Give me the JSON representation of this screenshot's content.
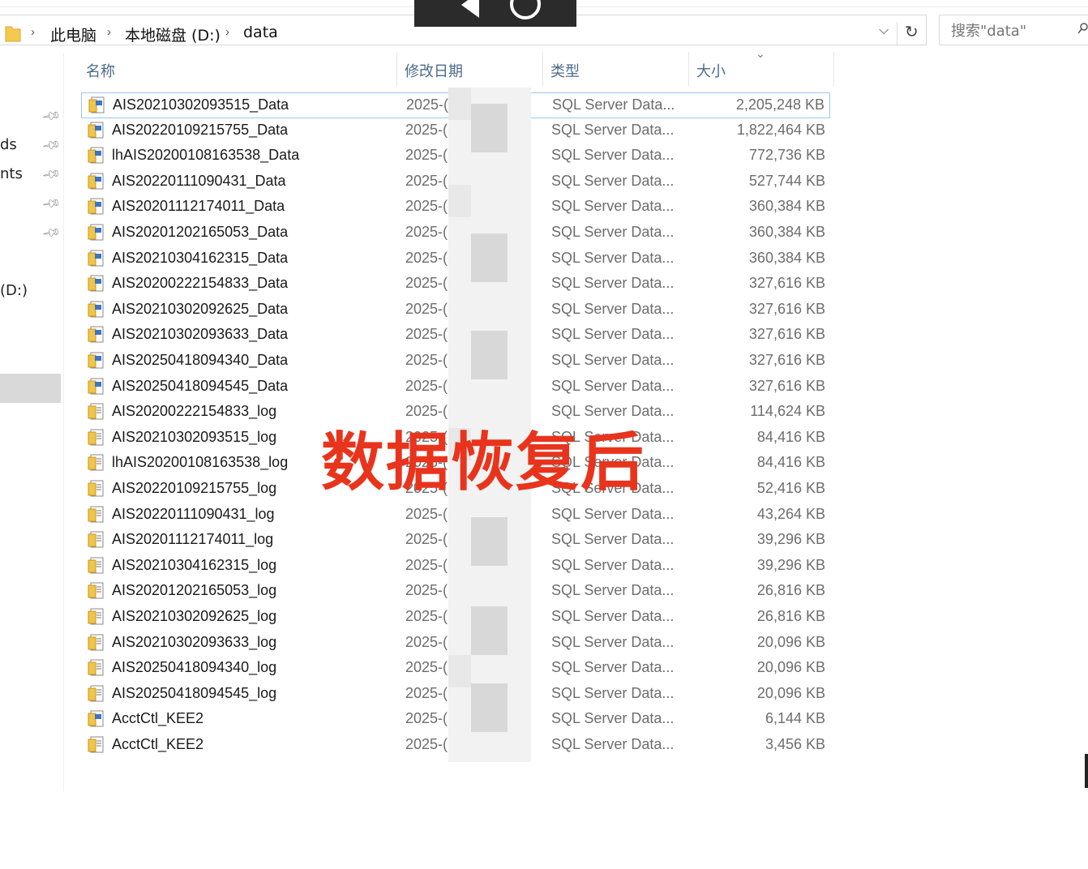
{
  "address_bar": {
    "breadcrumbs": [
      "此电脑",
      "本地磁盘 (D:)",
      "data"
    ],
    "search_placeholder": "搜索\"data\""
  },
  "nav_pane": {
    "items": [
      "ds",
      "nts",
      "(D:)"
    ]
  },
  "columns": {
    "name": "名称",
    "date": "修改日期",
    "type": "类型",
    "size": "大小"
  },
  "overlay_caption": "数据恢复后",
  "files": [
    {
      "name": "AIS20210302093515_Data",
      "date": "2025-(",
      "type": "SQL Server Data...",
      "size": "2,205,248 KB",
      "kind": "data"
    },
    {
      "name": "AIS20220109215755_Data",
      "date": "2025-(",
      "type": "SQL Server Data...",
      "size": "1,822,464 KB",
      "kind": "data"
    },
    {
      "name": "lhAIS20200108163538_Data",
      "date": "2025-(",
      "type": "SQL Server Data...",
      "size": "772,736 KB",
      "kind": "data"
    },
    {
      "name": "AIS20220111090431_Data",
      "date": "2025-(",
      "type": "SQL Server Data...",
      "size": "527,744 KB",
      "kind": "data"
    },
    {
      "name": "AIS20201112174011_Data",
      "date": "2025-(",
      "type": "SQL Server Data...",
      "size": "360,384 KB",
      "kind": "data"
    },
    {
      "name": "AIS20201202165053_Data",
      "date": "2025-(",
      "type": "SQL Server Data...",
      "size": "360,384 KB",
      "kind": "data"
    },
    {
      "name": "AIS20210304162315_Data",
      "date": "2025-(",
      "type": "SQL Server Data...",
      "size": "360,384 KB",
      "kind": "data"
    },
    {
      "name": "AIS20200222154833_Data",
      "date": "2025-(",
      "type": "SQL Server Data...",
      "size": "327,616 KB",
      "kind": "data"
    },
    {
      "name": "AIS20210302092625_Data",
      "date": "2025-(",
      "type": "SQL Server Data...",
      "size": "327,616 KB",
      "kind": "data"
    },
    {
      "name": "AIS20210302093633_Data",
      "date": "2025-(",
      "type": "SQL Server Data...",
      "size": "327,616 KB",
      "kind": "data"
    },
    {
      "name": "AIS20250418094340_Data",
      "date": "2025-(",
      "type": "SQL Server Data...",
      "size": "327,616 KB",
      "kind": "data"
    },
    {
      "name": "AIS20250418094545_Data",
      "date": "2025-(",
      "type": "SQL Server Data...",
      "size": "327,616 KB",
      "kind": "data"
    },
    {
      "name": "AIS20200222154833_log",
      "date": "2025-(",
      "type": "SQL Server Data...",
      "size": "114,624 KB",
      "kind": "log"
    },
    {
      "name": "AIS20210302093515_log",
      "date": "2025-(",
      "type": "SQL Server Data...",
      "size": "84,416 KB",
      "kind": "log"
    },
    {
      "name": "lhAIS20200108163538_log",
      "date": "2025-(",
      "type": "SQL Server Data...",
      "size": "84,416 KB",
      "kind": "log"
    },
    {
      "name": "AIS20220109215755_log",
      "date": "2025-(",
      "type": "SQL Server Data...",
      "size": "52,416 KB",
      "kind": "log"
    },
    {
      "name": "AIS20220111090431_log",
      "date": "2025-(",
      "type": "SQL Server Data...",
      "size": "43,264 KB",
      "kind": "log"
    },
    {
      "name": "AIS20201112174011_log",
      "date": "2025-(",
      "type": "SQL Server Data...",
      "size": "39,296 KB",
      "kind": "log"
    },
    {
      "name": "AIS20210304162315_log",
      "date": "2025-(",
      "type": "SQL Server Data...",
      "size": "39,296 KB",
      "kind": "log"
    },
    {
      "name": "AIS20201202165053_log",
      "date": "2025-(",
      "type": "SQL Server Data...",
      "size": "26,816 KB",
      "kind": "log"
    },
    {
      "name": "AIS20210302092625_log",
      "date": "2025-(",
      "type": "SQL Server Data...",
      "size": "26,816 KB",
      "kind": "log"
    },
    {
      "name": "AIS20210302093633_log",
      "date": "2025-(",
      "type": "SQL Server Data...",
      "size": "20,096 KB",
      "kind": "log"
    },
    {
      "name": "AIS20250418094340_log",
      "date": "2025-(",
      "type": "SQL Server Data...",
      "size": "20,096 KB",
      "kind": "log"
    },
    {
      "name": "AIS20250418094545_log",
      "date": "2025-(",
      "type": "SQL Server Data...",
      "size": "20,096 KB",
      "kind": "log"
    },
    {
      "name": "AcctCtl_KEE2",
      "date": "2025-(",
      "type": "SQL Server Data...",
      "size": "6,144 KB",
      "kind": "data"
    },
    {
      "name": "AcctCtl_KEE2",
      "date": "2025-(",
      "type": "SQL Server Data...",
      "size": "3,456 KB",
      "kind": "log"
    }
  ]
}
